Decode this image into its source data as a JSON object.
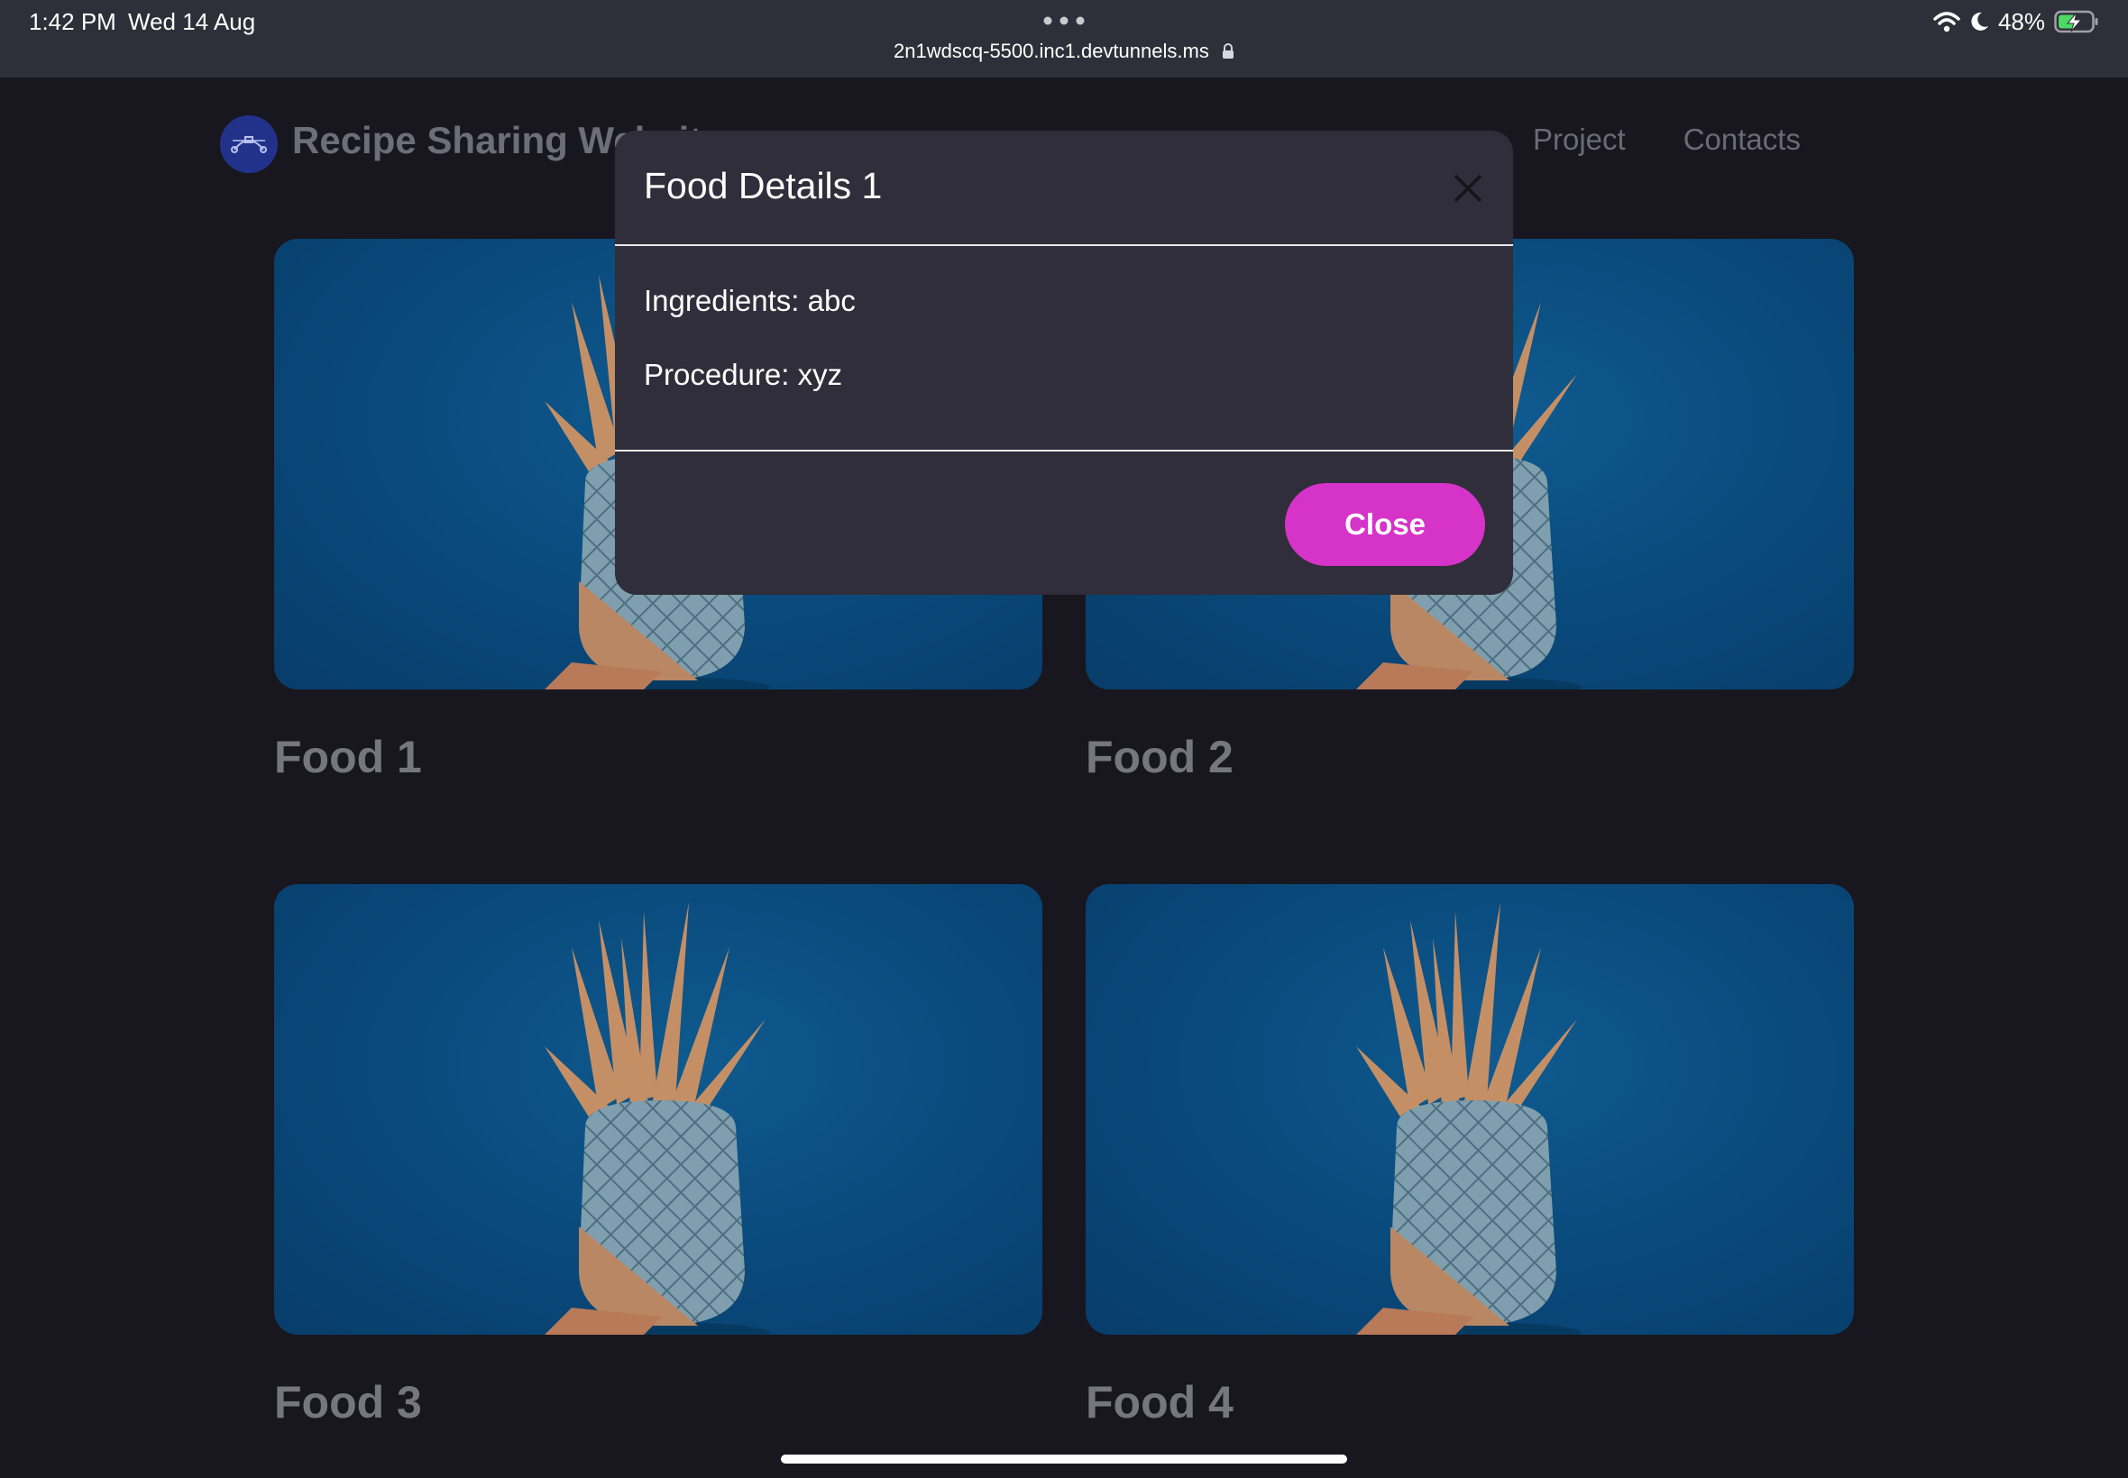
{
  "status_bar": {
    "time": "1:42 PM",
    "date": "Wed 14 Aug",
    "url": "2n1wdscq-5500.inc1.devtunnels.ms",
    "battery": "48%"
  },
  "navbar": {
    "brand": "Recipe Sharing Website",
    "links": [
      "Project",
      "Contacts"
    ]
  },
  "foods": [
    {
      "title": "Food 1"
    },
    {
      "title": "Food 2"
    },
    {
      "title": "Food 3"
    },
    {
      "title": "Food 4"
    }
  ],
  "modal": {
    "title": "Food Details 1",
    "ingredients": "Ingredients: abc",
    "procedure": "Procedure: xyz",
    "close_label": "Close"
  },
  "colors": {
    "page_bg": "#18171f",
    "modal_bg": "#2f2e3a",
    "accent": "#d633c8",
    "card_bg": "#0a4a7c"
  }
}
